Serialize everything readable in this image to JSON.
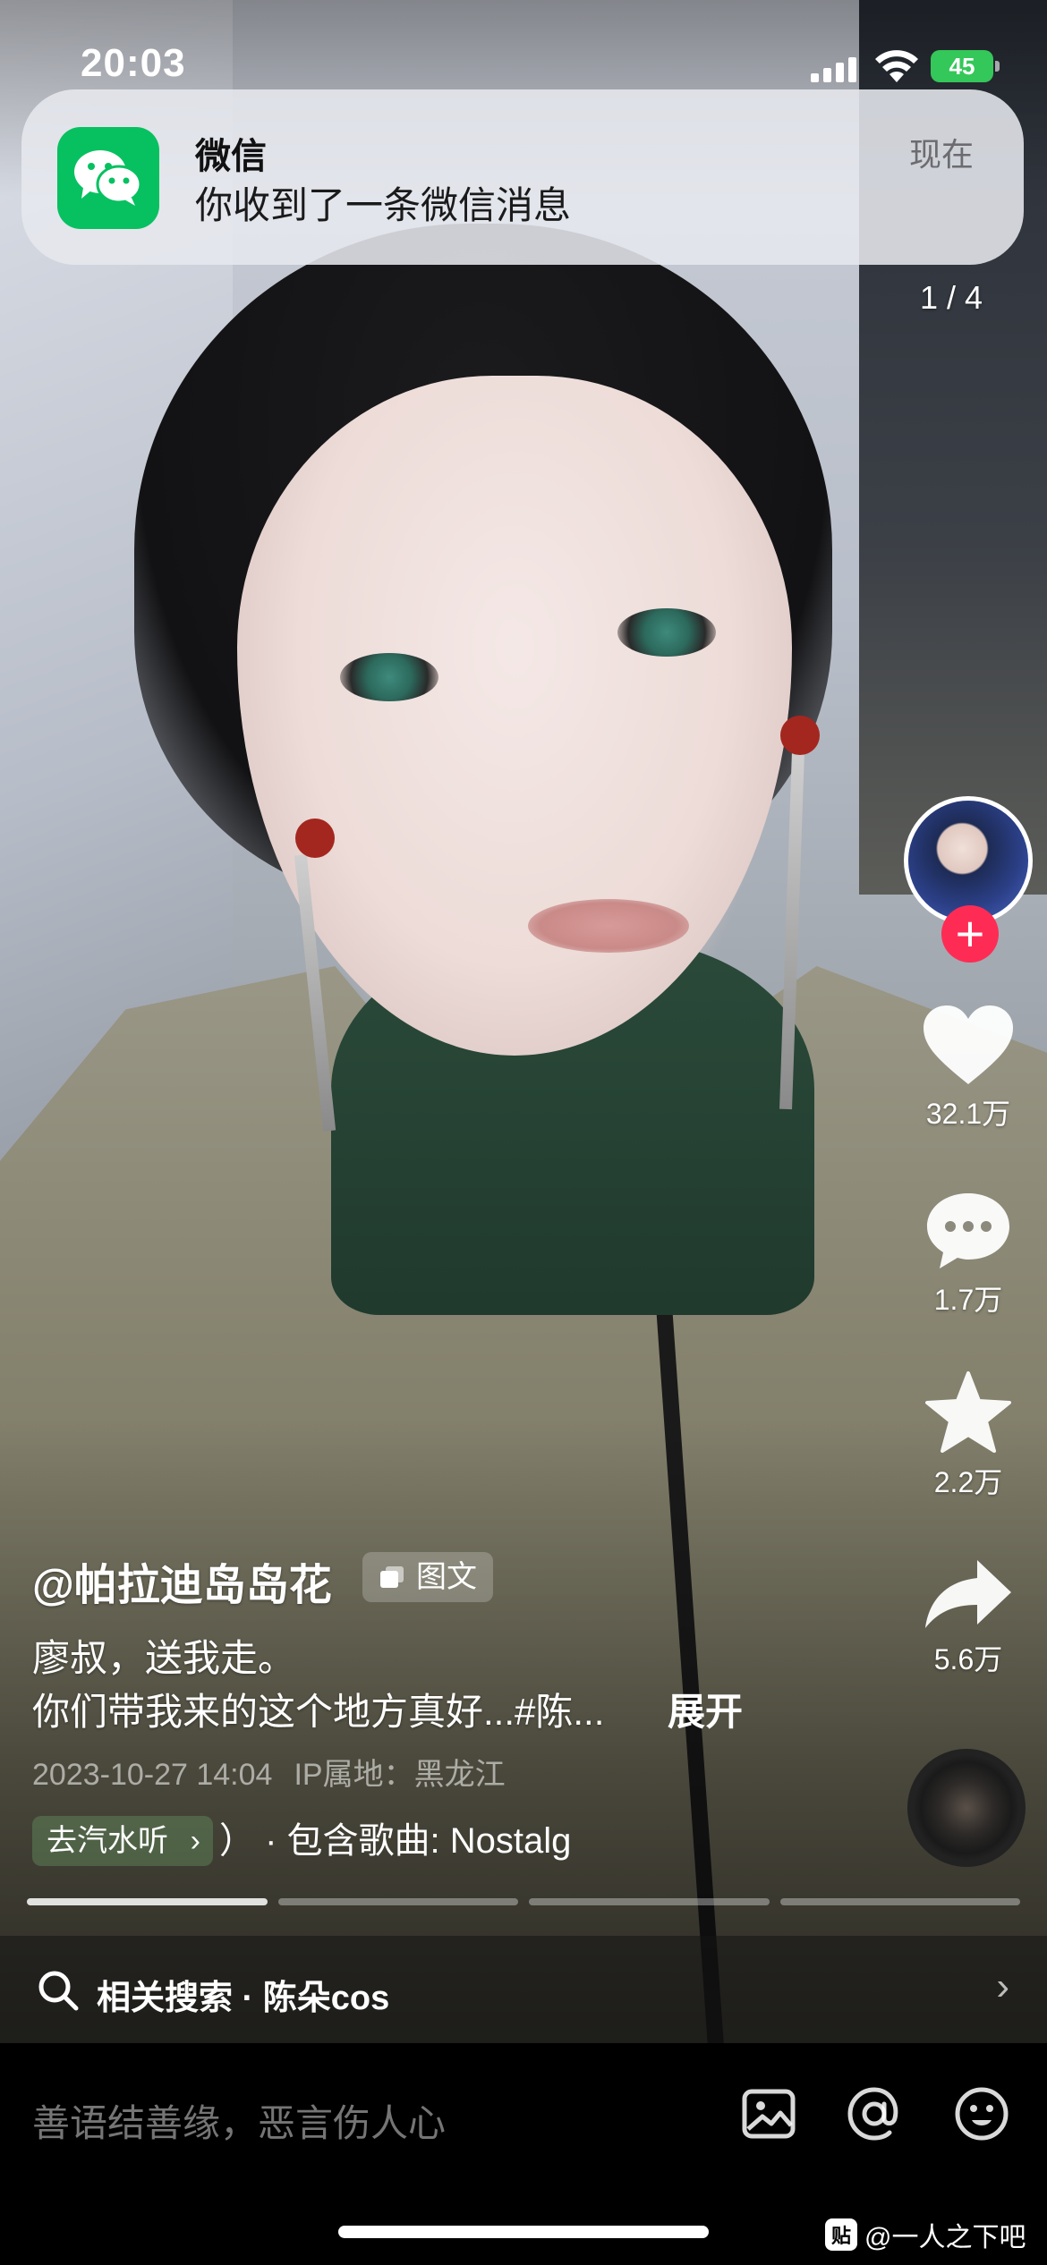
{
  "status_bar": {
    "time": "20:03",
    "battery": "45"
  },
  "notification": {
    "app_name": "微信",
    "message": "你收到了一条微信消息",
    "when": "现在",
    "icon": "wechat-icon"
  },
  "pager": "1 / 4",
  "actions": {
    "likes": "32.1万",
    "comments": "1.7万",
    "favorites": "2.2万",
    "shares": "5.6万"
  },
  "post": {
    "author": "@帕拉迪岛岛花",
    "type_tag": "图文",
    "caption_line1": "廖叔，送我走。",
    "caption_line2": "你们带我来的这个地方真好...#陈...",
    "expand_label": "展开",
    "date": "2023-10-27 14:04",
    "ip_location": "IP属地：黑龙江",
    "music_chip": "去汽水听",
    "song": "）  · 包含歌曲: Nostalg",
    "segments_total": 4,
    "segment_active": 1
  },
  "related_search": {
    "label": "相关搜索 · 陈朵cos"
  },
  "comment_bar": {
    "placeholder": "善语结善缘，恶言伤人心"
  },
  "watermark": {
    "logo": "贴",
    "text": "@一人之下吧"
  },
  "colors": {
    "accent_red": "#fe2c55",
    "wechat_green": "#07c160",
    "battery_green": "#34c759"
  }
}
